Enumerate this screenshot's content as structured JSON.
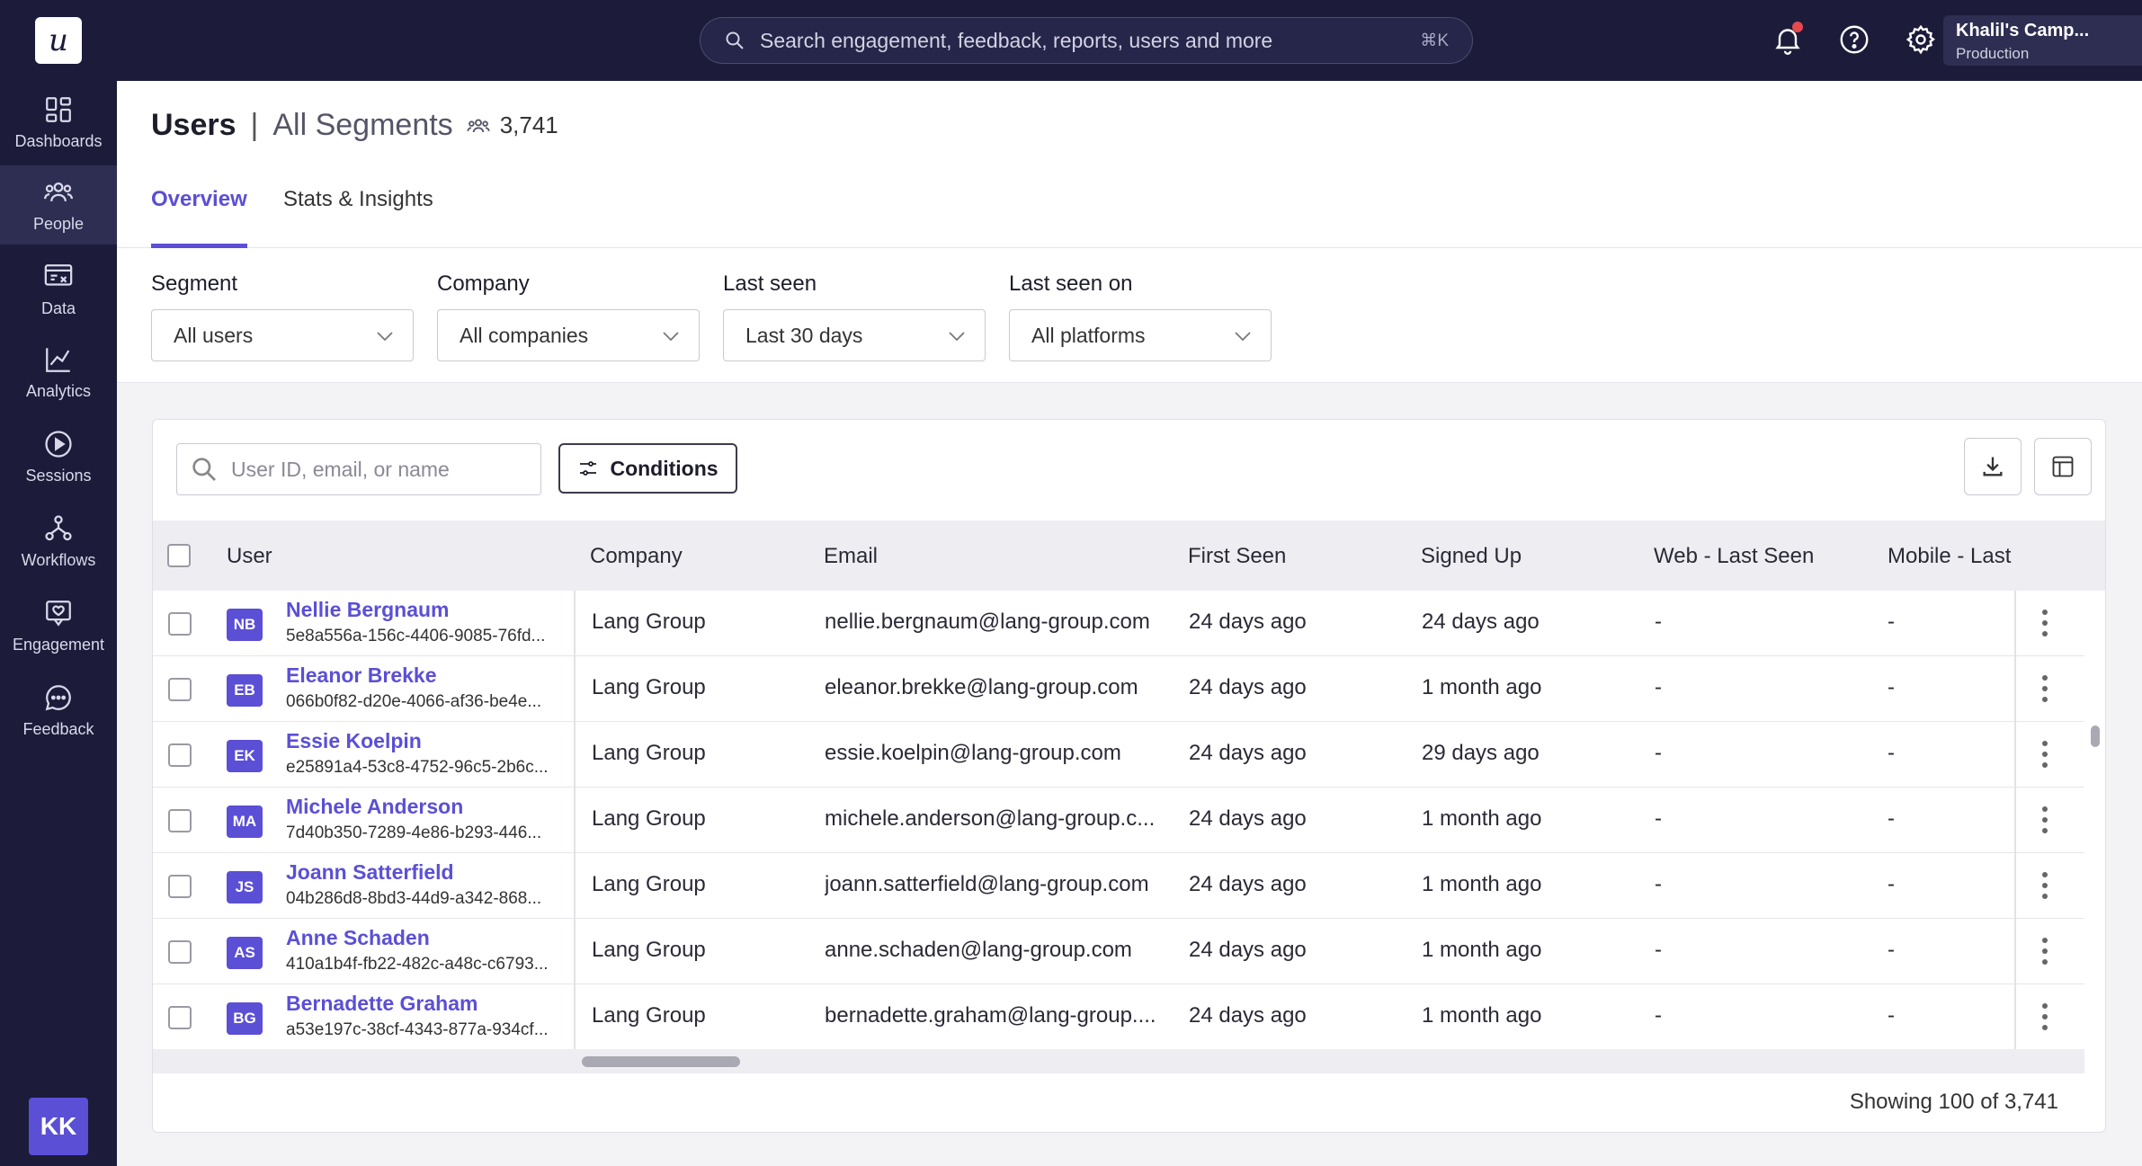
{
  "app": {
    "logo_letter": "u"
  },
  "nav": [
    {
      "key": "dashboards",
      "label": "Dashboards",
      "icon": "dashboard-icon",
      "active": false
    },
    {
      "key": "people",
      "label": "People",
      "icon": "people-icon",
      "active": true
    },
    {
      "key": "data",
      "label": "Data",
      "icon": "data-icon",
      "active": false
    },
    {
      "key": "analytics",
      "label": "Analytics",
      "icon": "analytics-icon",
      "active": false
    },
    {
      "key": "sessions",
      "label": "Sessions",
      "icon": "play-icon",
      "active": false
    },
    {
      "key": "workflows",
      "label": "Workflows",
      "icon": "workflow-icon",
      "active": false
    },
    {
      "key": "engagement",
      "label": "Engagement",
      "icon": "engagement-icon",
      "active": false
    },
    {
      "key": "feedback",
      "label": "Feedback",
      "icon": "chat-icon",
      "active": false
    }
  ],
  "user_avatar_initials": "KK",
  "topbar": {
    "search_text": "Search engagement, feedback, reports, users and more",
    "search_shortcut": "⌘K",
    "account_name": "Khalil's Camp...",
    "account_env": "Production"
  },
  "header": {
    "title": "Users",
    "separator": "|",
    "segment": "All Segments",
    "count": "3,741",
    "tabs": [
      {
        "label": "Overview",
        "active": true
      },
      {
        "label": "Stats & Insights",
        "active": false
      }
    ]
  },
  "filters": [
    {
      "label": "Segment",
      "value": "All users"
    },
    {
      "label": "Company",
      "value": "All companies"
    },
    {
      "label": "Last seen",
      "value": "Last 30 days"
    },
    {
      "label": "Last seen on",
      "value": "All platforms"
    }
  ],
  "table": {
    "search_placeholder": "User ID, email, or name",
    "conditions_label": "Conditions",
    "columns": [
      "User",
      "Company",
      "Email",
      "First Seen",
      "Signed Up",
      "Web - Last Seen",
      "Mobile - Last"
    ],
    "rows": [
      {
        "initials": "NB",
        "name": "Nellie Bergnaum",
        "id": "5e8a556a-156c-4406-9085-76fd...",
        "company": "Lang Group",
        "email": "nellie.bergnaum@lang-group.com",
        "first_seen": "24 days ago",
        "signed_up": "24 days ago",
        "web_last": "-",
        "mobile_last": "-"
      },
      {
        "initials": "EB",
        "name": "Eleanor Brekke",
        "id": "066b0f82-d20e-4066-af36-be4e...",
        "company": "Lang Group",
        "email": "eleanor.brekke@lang-group.com",
        "first_seen": "24 days ago",
        "signed_up": "1 month ago",
        "web_last": "-",
        "mobile_last": "-"
      },
      {
        "initials": "EK",
        "name": "Essie Koelpin",
        "id": "e25891a4-53c8-4752-96c5-2b6c...",
        "company": "Lang Group",
        "email": "essie.koelpin@lang-group.com",
        "first_seen": "24 days ago",
        "signed_up": "29 days ago",
        "web_last": "-",
        "mobile_last": "-"
      },
      {
        "initials": "MA",
        "name": "Michele Anderson",
        "id": "7d40b350-7289-4e86-b293-446...",
        "company": "Lang Group",
        "email": "michele.anderson@lang-group.c...",
        "first_seen": "24 days ago",
        "signed_up": "1 month ago",
        "web_last": "-",
        "mobile_last": "-"
      },
      {
        "initials": "JS",
        "name": "Joann Satterfield",
        "id": "04b286d8-8bd3-44d9-a342-868...",
        "company": "Lang Group",
        "email": "joann.satterfield@lang-group.com",
        "first_seen": "24 days ago",
        "signed_up": "1 month ago",
        "web_last": "-",
        "mobile_last": "-"
      },
      {
        "initials": "AS",
        "name": "Anne Schaden",
        "id": "410a1b4f-fb22-482c-a48c-c6793...",
        "company": "Lang Group",
        "email": "anne.schaden@lang-group.com",
        "first_seen": "24 days ago",
        "signed_up": "1 month ago",
        "web_last": "-",
        "mobile_last": "-"
      },
      {
        "initials": "BG",
        "name": "Bernadette Graham",
        "id": "a53e197c-38cf-4343-877a-934cf...",
        "company": "Lang Group",
        "email": "bernadette.graham@lang-group....",
        "first_seen": "24 days ago",
        "signed_up": "1 month ago",
        "web_last": "-",
        "mobile_last": "-"
      }
    ],
    "footer": "Showing 100 of 3,741"
  },
  "colors": {
    "sidebar": "#1c1b3a",
    "accent": "#5b4fd6",
    "notification": "#e5484d"
  }
}
